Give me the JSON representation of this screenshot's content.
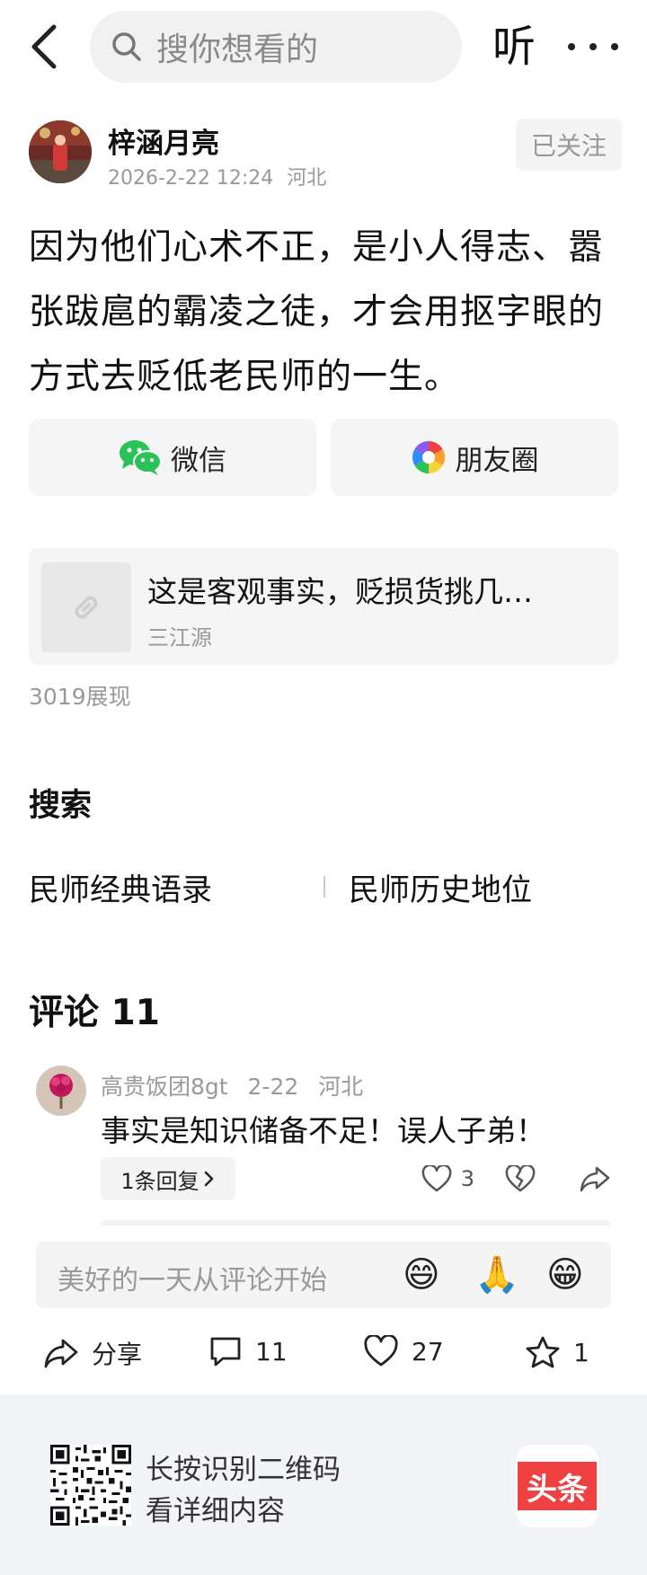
{
  "header": {
    "search_placeholder": "搜你想看的",
    "listen_label": "听"
  },
  "author": {
    "name": "梓涵月亮",
    "timestamp": "2026-2-22 12:24",
    "location": "河北",
    "follow_label": "已关注"
  },
  "article": {
    "text": "因为他们心术不正，是小人得志、嚣张跋扈的霸凌之徒，才会用抠字眼的方式去贬低老民师的一生。"
  },
  "share": {
    "wechat_label": "微信",
    "moments_label": "朋友圈"
  },
  "link_card": {
    "title": "这是客观事实，贬损货挑几…",
    "source": "三江源"
  },
  "views": "3019展现",
  "search_section": {
    "heading": "搜索",
    "suggestions": [
      "民师经典语录",
      "民师历史地位"
    ]
  },
  "comments": {
    "heading": "评论 11",
    "items": [
      {
        "user": "高贵饭团8gt",
        "date": "2-22",
        "location": "河北",
        "text": "事实是知识储备不足！误人子弟！",
        "reply_label": "1条回复",
        "likes": "3"
      }
    ]
  },
  "comment_input": {
    "placeholder": "美好的一天从评论开始",
    "emojis": [
      "😄",
      "🙏",
      "😁"
    ]
  },
  "bottom_bar": {
    "share_label": "分享",
    "comment_count": "11",
    "like_count": "27",
    "favorite_count": "1"
  },
  "footer": {
    "line1": "长按识别二维码",
    "line2": "看详细内容",
    "logo_text": "头条"
  },
  "colors": {
    "brand_red": "#f04142",
    "wechat_green": "#2bc25a"
  }
}
